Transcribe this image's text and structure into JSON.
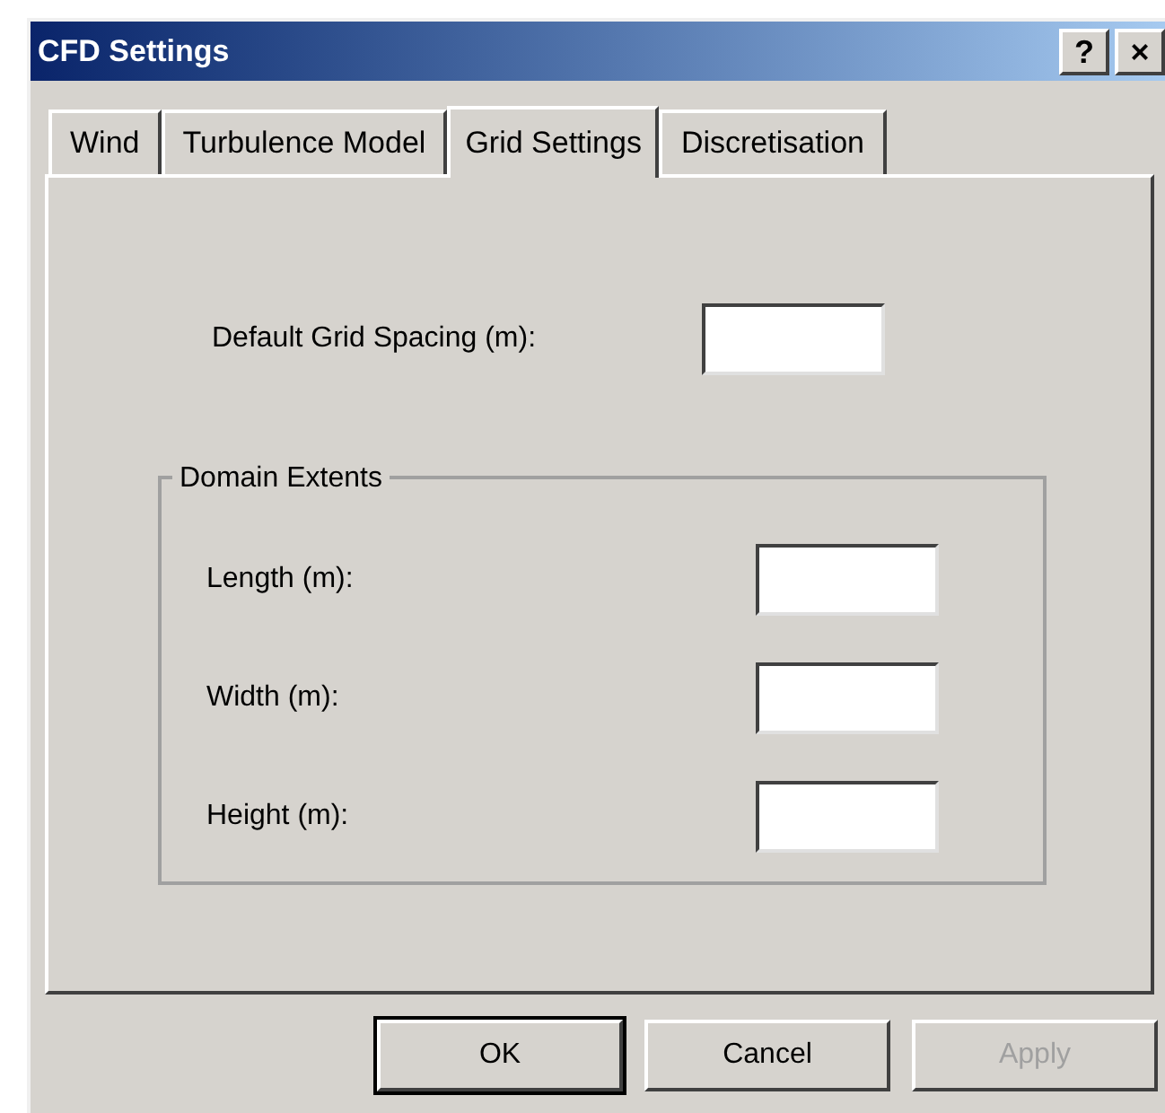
{
  "window": {
    "title": "CFD Settings",
    "title_buttons": [
      "?",
      "×"
    ]
  },
  "tabs": [
    {
      "label": "Wind",
      "selected": false
    },
    {
      "label": "Turbulence Model",
      "selected": false
    },
    {
      "label": "Grid Settings",
      "selected": true
    },
    {
      "label": "Discretisation",
      "selected": false
    }
  ],
  "default_grid_spacing": {
    "label": "Default Grid Spacing (m):"
  },
  "domain_extents": {
    "title": "Domain Extents",
    "fields": [
      {
        "label": "Length (m):"
      },
      {
        "label": "Width (m):"
      },
      {
        "label": "Height (m):"
      }
    ]
  },
  "buttons": [
    {
      "label": "OK",
      "default": true,
      "disabled": false
    },
    {
      "label": "Cancel",
      "default": false,
      "disabled": false
    },
    {
      "label": "Apply",
      "default": false,
      "disabled": true
    }
  ]
}
